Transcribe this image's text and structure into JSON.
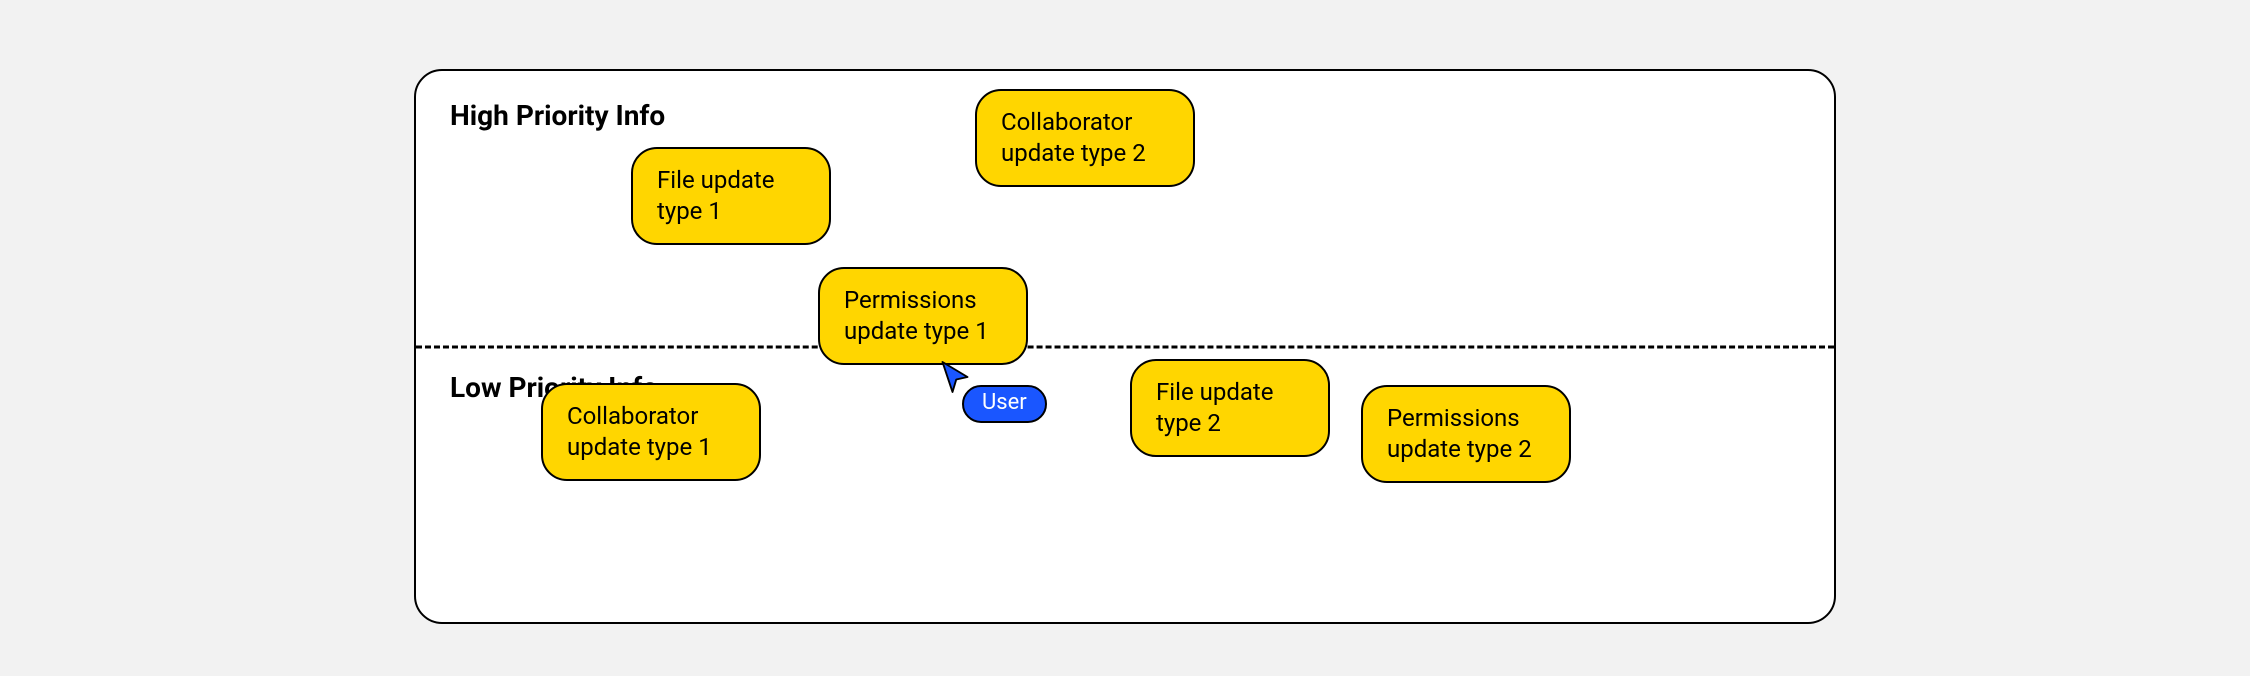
{
  "sections": {
    "high_label": "High Priority Info",
    "low_label": "Low Priority Info"
  },
  "chips": {
    "file_update_1": "File update type 1",
    "collab_update_2": "Collaborator update type 2",
    "perm_update_1": "Permissions update type 1",
    "collab_update_1": "Collaborator update type 1",
    "file_update_2": "File update type 2",
    "perm_update_2": "Permissions update type 2"
  },
  "cursor": {
    "label": "User"
  },
  "colors": {
    "chip_fill": "#ffd600",
    "chip_stroke": "#000000",
    "cursor_fill": "#1a56ff",
    "panel_bg": "#ffffff",
    "page_bg": "#f2f2f2"
  }
}
